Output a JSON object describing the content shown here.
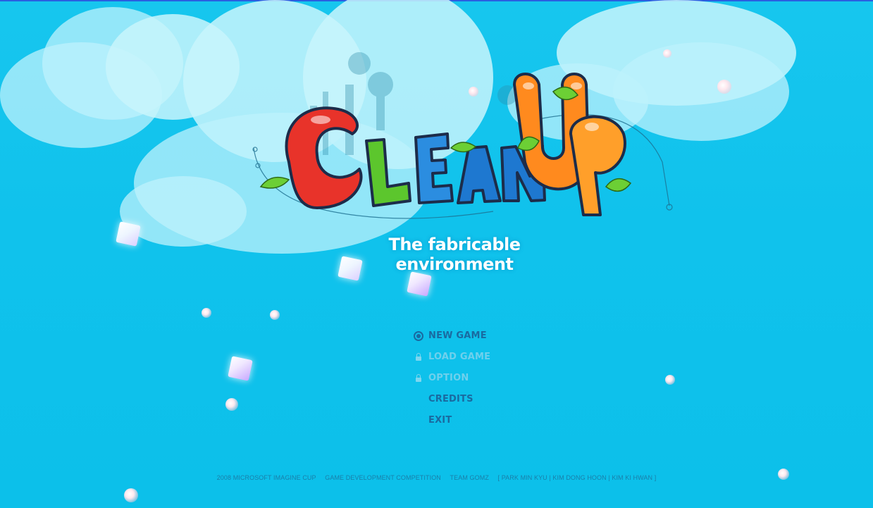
{
  "game": {
    "tagline": "The fabricable environment"
  },
  "menu": {
    "items": [
      {
        "label": "NEW GAME",
        "state": "selected",
        "icon": "ring-selector-icon"
      },
      {
        "label": "LOAD GAME",
        "state": "locked",
        "icon": "lock-icon"
      },
      {
        "label": "OPTION",
        "state": "locked",
        "icon": "lock-icon"
      },
      {
        "label": "CREDITS",
        "state": "enabled",
        "icon": ""
      },
      {
        "label": "EXIT",
        "state": "enabled",
        "icon": ""
      }
    ]
  },
  "footer": {
    "competition": "2008 MICROSOFT IMAGINE CUP",
    "category": "GAME DEVELOPMENT COMPETITION",
    "team": "TEAM GOMZ",
    "members": "[ PARK MIN KYU | KIM DONG HOON | KIM KI HWAN ]"
  },
  "colors": {
    "sky": "#10c2ec",
    "menu_active": "#1a6aa0",
    "menu_disabled": "#6fd0ec",
    "logo_red": "#e8332a",
    "logo_green": "#5cc62d",
    "logo_blue": "#1e78d0",
    "logo_orange": "#ff8a1e"
  }
}
